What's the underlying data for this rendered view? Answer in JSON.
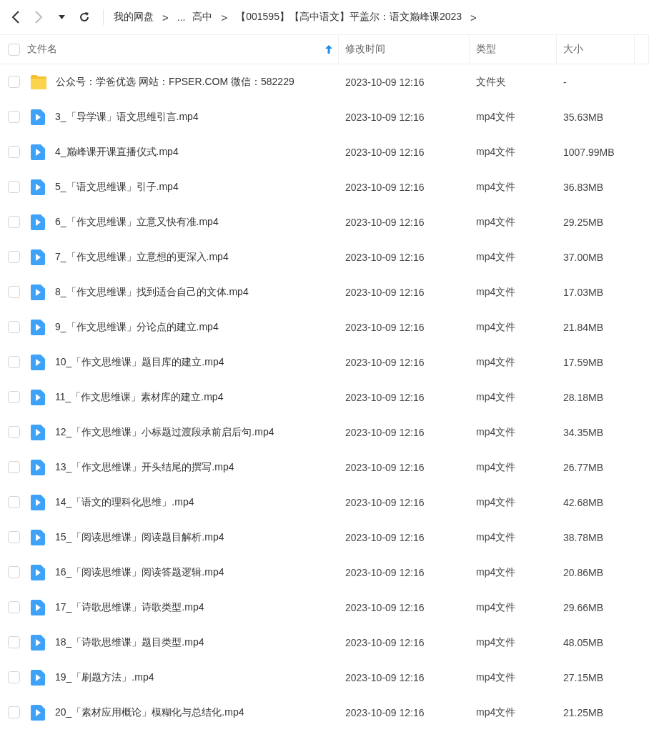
{
  "toolbar": {
    "nav_buttons": [
      {
        "kind": "back",
        "disabled": false
      },
      {
        "kind": "forward",
        "disabled": true
      },
      {
        "kind": "dropdown",
        "disabled": false
      },
      {
        "kind": "refresh",
        "disabled": false
      }
    ],
    "breadcrumb": [
      {
        "kind": "crumb",
        "text": "我的网盘"
      },
      {
        "kind": "sep",
        "text": ">"
      },
      {
        "kind": "crumb",
        "text": "..."
      },
      {
        "kind": "crumb",
        "text": "高中"
      },
      {
        "kind": "sep",
        "text": ">"
      },
      {
        "kind": "crumb",
        "text": "【001595】【高中语文】平盖尔：语文巅峰课2023"
      },
      {
        "kind": "sep",
        "text": ">"
      }
    ]
  },
  "table": {
    "select_all": {
      "checked": false
    },
    "columns": [
      {
        "label": "文件名",
        "sorted": true
      },
      {
        "label": "修改时间",
        "sorted": false
      },
      {
        "label": "类型",
        "sorted": false
      },
      {
        "label": "大小",
        "sorted": false
      }
    ],
    "rows": [
      {
        "kind": "folder",
        "checked": false,
        "name": "公众号：学爸优选 网站：FPSER.COM 微信：582229",
        "modified": "2023-10-09 12:16",
        "type": "文件夹",
        "size": "-"
      },
      {
        "kind": "video",
        "checked": false,
        "name": "3_「导学课」语文思维引言.mp4",
        "modified": "2023-10-09 12:16",
        "type": "mp4文件",
        "size": "35.63MB"
      },
      {
        "kind": "video",
        "checked": false,
        "name": "4_巅峰课开课直播仪式.mp4",
        "modified": "2023-10-09 12:16",
        "type": "mp4文件",
        "size": "1007.99MB"
      },
      {
        "kind": "video",
        "checked": false,
        "name": "5_「语文思维课」引子.mp4",
        "modified": "2023-10-09 12:16",
        "type": "mp4文件",
        "size": "36.83MB"
      },
      {
        "kind": "video",
        "checked": false,
        "name": "6_「作文思维课」立意又快有准.mp4",
        "modified": "2023-10-09 12:16",
        "type": "mp4文件",
        "size": "29.25MB"
      },
      {
        "kind": "video",
        "checked": false,
        "name": "7_「作文思维课」立意想的更深入.mp4",
        "modified": "2023-10-09 12:16",
        "type": "mp4文件",
        "size": "37.00MB"
      },
      {
        "kind": "video",
        "checked": false,
        "name": "8_「作文思维课」找到适合自己的文体.mp4",
        "modified": "2023-10-09 12:16",
        "type": "mp4文件",
        "size": "17.03MB"
      },
      {
        "kind": "video",
        "checked": false,
        "name": "9_「作文思维课」分论点的建立.mp4",
        "modified": "2023-10-09 12:16",
        "type": "mp4文件",
        "size": "21.84MB"
      },
      {
        "kind": "video",
        "checked": false,
        "name": "10_「作文思维课」题目库的建立.mp4",
        "modified": "2023-10-09 12:16",
        "type": "mp4文件",
        "size": "17.59MB"
      },
      {
        "kind": "video",
        "checked": false,
        "name": "11_「作文思维课」素材库的建立.mp4",
        "modified": "2023-10-09 12:16",
        "type": "mp4文件",
        "size": "28.18MB"
      },
      {
        "kind": "video",
        "checked": false,
        "name": "12_「作文思维课」小标题过渡段承前启后句.mp4",
        "modified": "2023-10-09 12:16",
        "type": "mp4文件",
        "size": "34.35MB"
      },
      {
        "kind": "video",
        "checked": false,
        "name": "13_「作文思维课」开头结尾的撰写.mp4",
        "modified": "2023-10-09 12:16",
        "type": "mp4文件",
        "size": "26.77MB"
      },
      {
        "kind": "video",
        "checked": false,
        "name": "14_「语文的理科化思维」.mp4",
        "modified": "2023-10-09 12:16",
        "type": "mp4文件",
        "size": "42.68MB"
      },
      {
        "kind": "video",
        "checked": false,
        "name": "15_「阅读思维课」阅读题目解析.mp4",
        "modified": "2023-10-09 12:16",
        "type": "mp4文件",
        "size": "38.78MB"
      },
      {
        "kind": "video",
        "checked": false,
        "name": "16_「阅读思维课」阅读答题逻辑.mp4",
        "modified": "2023-10-09 12:16",
        "type": "mp4文件",
        "size": "20.86MB"
      },
      {
        "kind": "video",
        "checked": false,
        "name": "17_「诗歌思维课」诗歌类型.mp4",
        "modified": "2023-10-09 12:16",
        "type": "mp4文件",
        "size": "29.66MB"
      },
      {
        "kind": "video",
        "checked": false,
        "name": "18_「诗歌思维课」题目类型.mp4",
        "modified": "2023-10-09 12:16",
        "type": "mp4文件",
        "size": "48.05MB"
      },
      {
        "kind": "video",
        "checked": false,
        "name": "19_「刷题方法」.mp4",
        "modified": "2023-10-09 12:16",
        "type": "mp4文件",
        "size": "27.15MB"
      },
      {
        "kind": "video",
        "checked": false,
        "name": "20_「素材应用概论」模糊化与总结化.mp4",
        "modified": "2023-10-09 12:16",
        "type": "mp4文件",
        "size": "21.25MB"
      }
    ]
  }
}
